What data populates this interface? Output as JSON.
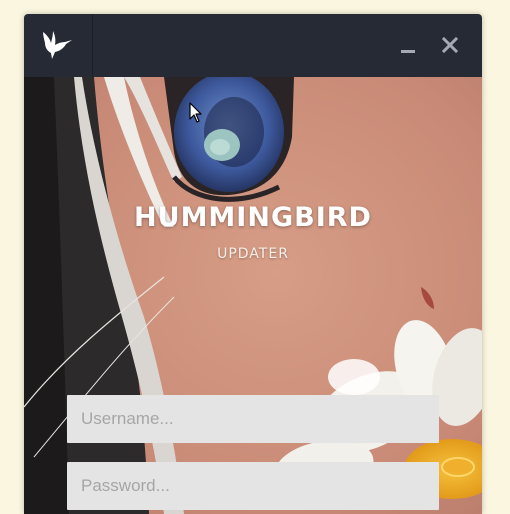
{
  "window": {
    "brand_title": "HUMMINGBIRD",
    "brand_subtitle": "UPDATER",
    "titlebar_color": "#252a35"
  },
  "titlebar": {
    "logo_icon": "hummingbird-icon",
    "minimize_icon": "minimize-icon",
    "close_icon": "close-icon"
  },
  "form": {
    "username_placeholder": "Username...",
    "username_value": "",
    "password_placeholder": "Password...",
    "password_value": ""
  }
}
